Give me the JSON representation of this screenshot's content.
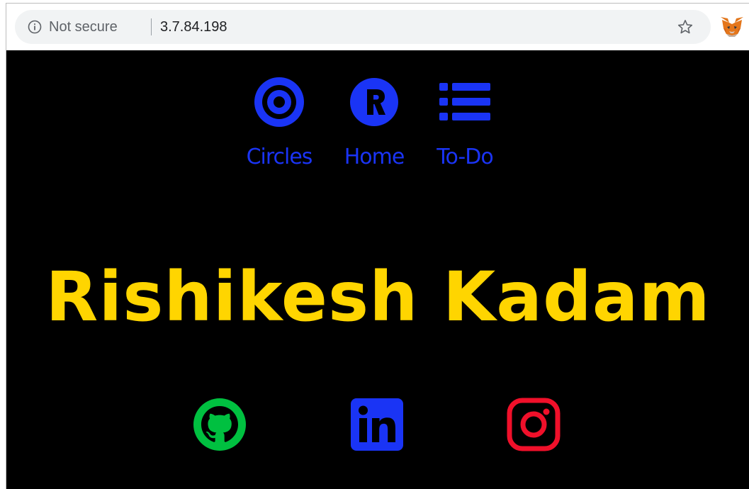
{
  "browser": {
    "security_label": "Not secure",
    "url": "3.7.84.198",
    "icons": [
      "info-icon",
      "star-icon",
      "metamask-fox-icon"
    ]
  },
  "nav": {
    "items": [
      {
        "label": "Circles",
        "icon": "target-circles-icon"
      },
      {
        "label": "Home",
        "icon": "r-logo-icon"
      },
      {
        "label": "To-Do",
        "icon": "list-icon"
      }
    ],
    "color": "#1a34f5"
  },
  "hero": {
    "name": "Rishikesh Kadam",
    "color": "#ffd500"
  },
  "social": [
    {
      "icon": "github-icon",
      "color": "#00c040"
    },
    {
      "icon": "linkedin-icon",
      "color": "#1a34f5"
    },
    {
      "icon": "instagram-icon",
      "color": "#f0102a"
    }
  ]
}
